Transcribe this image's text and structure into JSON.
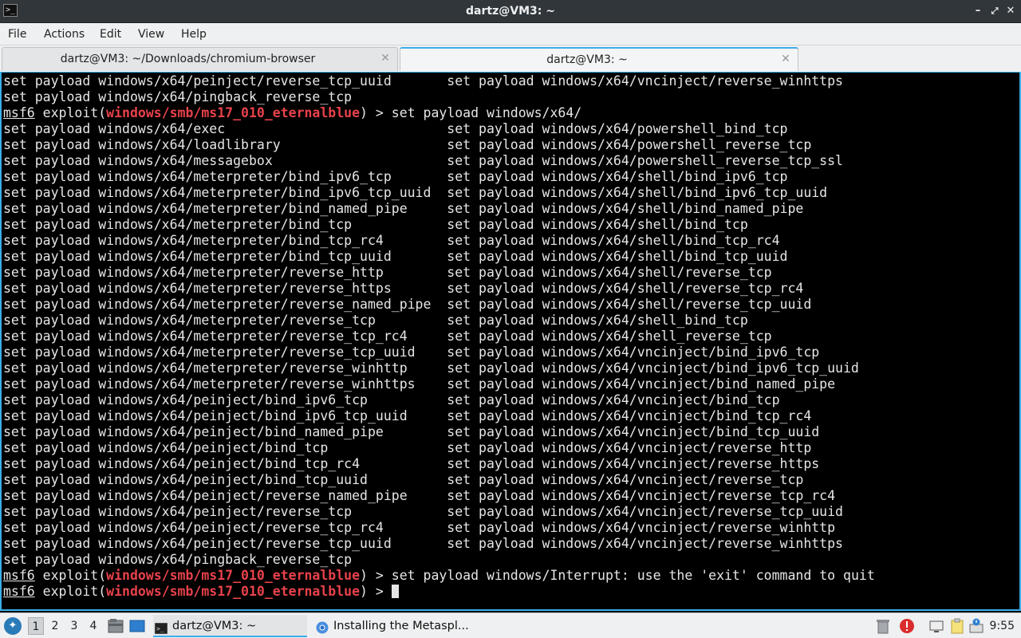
{
  "window": {
    "title": "dartz@VM3: ~",
    "icon": "terminal-icon",
    "controls": [
      "minimize",
      "maximize",
      "close"
    ]
  },
  "menubar": [
    "File",
    "Actions",
    "Edit",
    "View",
    "Help"
  ],
  "tabs": [
    {
      "label": "dartz@VM3: ~/Downloads/chromium-browser",
      "active": false
    },
    {
      "label": "dartz@VM3: ~",
      "active": true
    }
  ],
  "terminal": {
    "colors": {
      "text": "#e6e6e6",
      "module": "#e8424b",
      "border": "#3daee9"
    },
    "lines": [
      {
        "t": "set payload windows/x64/peinject/reverse_tcp_uuid       set payload windows/x64/vncinject/reverse_winhttps"
      },
      {
        "t": "set payload windows/x64/pingback_reverse_tcp"
      },
      {
        "prompt": "msf6",
        "mid": " exploit(",
        "module": "windows/smb/ms17_010_eternalblue",
        "rest": ") > set payload windows/x64/"
      },
      {
        "t": "set payload windows/x64/exec                            set payload windows/x64/powershell_bind_tcp"
      },
      {
        "t": "set payload windows/x64/loadlibrary                     set payload windows/x64/powershell_reverse_tcp"
      },
      {
        "t": "set payload windows/x64/messagebox                      set payload windows/x64/powershell_reverse_tcp_ssl"
      },
      {
        "t": "set payload windows/x64/meterpreter/bind_ipv6_tcp       set payload windows/x64/shell/bind_ipv6_tcp"
      },
      {
        "t": "set payload windows/x64/meterpreter/bind_ipv6_tcp_uuid  set payload windows/x64/shell/bind_ipv6_tcp_uuid"
      },
      {
        "t": "set payload windows/x64/meterpreter/bind_named_pipe     set payload windows/x64/shell/bind_named_pipe"
      },
      {
        "t": "set payload windows/x64/meterpreter/bind_tcp            set payload windows/x64/shell/bind_tcp"
      },
      {
        "t": "set payload windows/x64/meterpreter/bind_tcp_rc4        set payload windows/x64/shell/bind_tcp_rc4"
      },
      {
        "t": "set payload windows/x64/meterpreter/bind_tcp_uuid       set payload windows/x64/shell/bind_tcp_uuid"
      },
      {
        "t": "set payload windows/x64/meterpreter/reverse_http        set payload windows/x64/shell/reverse_tcp"
      },
      {
        "t": "set payload windows/x64/meterpreter/reverse_https       set payload windows/x64/shell/reverse_tcp_rc4"
      },
      {
        "t": "set payload windows/x64/meterpreter/reverse_named_pipe  set payload windows/x64/shell/reverse_tcp_uuid"
      },
      {
        "t": "set payload windows/x64/meterpreter/reverse_tcp         set payload windows/x64/shell_bind_tcp"
      },
      {
        "t": "set payload windows/x64/meterpreter/reverse_tcp_rc4     set payload windows/x64/shell_reverse_tcp"
      },
      {
        "t": "set payload windows/x64/meterpreter/reverse_tcp_uuid    set payload windows/x64/vncinject/bind_ipv6_tcp"
      },
      {
        "t": "set payload windows/x64/meterpreter/reverse_winhttp     set payload windows/x64/vncinject/bind_ipv6_tcp_uuid"
      },
      {
        "t": "set payload windows/x64/meterpreter/reverse_winhttps    set payload windows/x64/vncinject/bind_named_pipe"
      },
      {
        "t": "set payload windows/x64/peinject/bind_ipv6_tcp          set payload windows/x64/vncinject/bind_tcp"
      },
      {
        "t": "set payload windows/x64/peinject/bind_ipv6_tcp_uuid     set payload windows/x64/vncinject/bind_tcp_rc4"
      },
      {
        "t": "set payload windows/x64/peinject/bind_named_pipe        set payload windows/x64/vncinject/bind_tcp_uuid"
      },
      {
        "t": "set payload windows/x64/peinject/bind_tcp               set payload windows/x64/vncinject/reverse_http"
      },
      {
        "t": "set payload windows/x64/peinject/bind_tcp_rc4           set payload windows/x64/vncinject/reverse_https"
      },
      {
        "t": "set payload windows/x64/peinject/bind_tcp_uuid          set payload windows/x64/vncinject/reverse_tcp"
      },
      {
        "t": "set payload windows/x64/peinject/reverse_named_pipe     set payload windows/x64/vncinject/reverse_tcp_rc4"
      },
      {
        "t": "set payload windows/x64/peinject/reverse_tcp            set payload windows/x64/vncinject/reverse_tcp_uuid"
      },
      {
        "t": "set payload windows/x64/peinject/reverse_tcp_rc4        set payload windows/x64/vncinject/reverse_winhttp"
      },
      {
        "t": "set payload windows/x64/peinject/reverse_tcp_uuid       set payload windows/x64/vncinject/reverse_winhttps"
      },
      {
        "t": "set payload windows/x64/pingback_reverse_tcp"
      },
      {
        "prompt": "msf6",
        "mid": " exploit(",
        "module": "windows/smb/ms17_010_eternalblue",
        "rest": ") > set payload windows/Interrupt: use the 'exit' command to quit"
      },
      {
        "prompt": "msf6",
        "mid": " exploit(",
        "module": "windows/smb/ms17_010_eternalblue",
        "rest": ") > ",
        "cursor": true
      }
    ]
  },
  "taskbar": {
    "start_icon": "lubuntu-logo-icon",
    "desktops": [
      "1",
      "2",
      "3",
      "4"
    ],
    "active_desktop": "1",
    "tasks": [
      {
        "label": "dartz@VM3: ~",
        "icon": "terminal-icon",
        "active": true
      },
      {
        "label": "Installing the Metaspl...",
        "icon": "chromium-icon",
        "active": false
      }
    ],
    "clock": "9:55"
  }
}
